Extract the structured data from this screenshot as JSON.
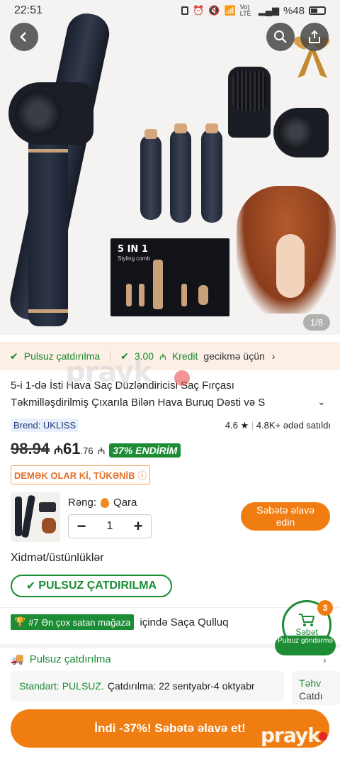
{
  "status_bar": {
    "time": "22:51",
    "network": "Vo) LTE",
    "battery": "%48"
  },
  "hero": {
    "box_title": "5 IN 1",
    "box_subtitle": "Styling comb",
    "image_counter": "1/8"
  },
  "shipping_strip": {
    "free_shipping": "Pulsuz çatdırılma",
    "credit_amount": "3.00",
    "credit_label": "Kredit",
    "credit_suffix": "gecikmə üçün"
  },
  "product": {
    "title": "5-i 1-də İsti Hava Saç Düzləndiricisi Saç Fırçası Təkmilləşdirilmiş Çıxarıla Bilən Hava Buruq Dəsti və S",
    "brand": "Brend: UKLISS",
    "rating": "4.6",
    "sold": "4.8K+ ədəd satıldı",
    "old_price": "98.94",
    "new_price_main": "61",
    "new_price_cents": ".76",
    "currency": "₼",
    "discount": "37% ENDİRİM",
    "almost_sold_out": "DEMƏK OLAR Kİ, TÜKƏNİB",
    "color_label": "Rəng:",
    "color_value": "Qara",
    "quantity": "1",
    "add_to_cart_small": "Səbətə əlavə edin"
  },
  "services": {
    "heading": "Xidmət/üstünlüklər",
    "free_badge": "PULSUZ ÇATDIRILMA"
  },
  "ranking": {
    "badge": "#7 Ən çox satan mağaza",
    "category": "içində Saça Qulluq"
  },
  "cart_float": {
    "label": "Səbət",
    "count": "3",
    "free_send": "Pulsuz göndərmə"
  },
  "delivery": {
    "heading": "Pulsuz çatdırılma",
    "standard_label": "Standart: PULSUZ.",
    "standard_text": "Çatdırılma: 22 sentyabr-4 oktyabr",
    "card2_top": "Təhv",
    "card2_bottom": "Catdı"
  },
  "bottom_cta": {
    "label": "İndi -37%! Səbətə əlavə et!"
  },
  "watermark": "prayk",
  "colors": {
    "accent_orange": "#f07d12",
    "green": "#1c8c35",
    "strip_bg": "#fbefe6"
  }
}
